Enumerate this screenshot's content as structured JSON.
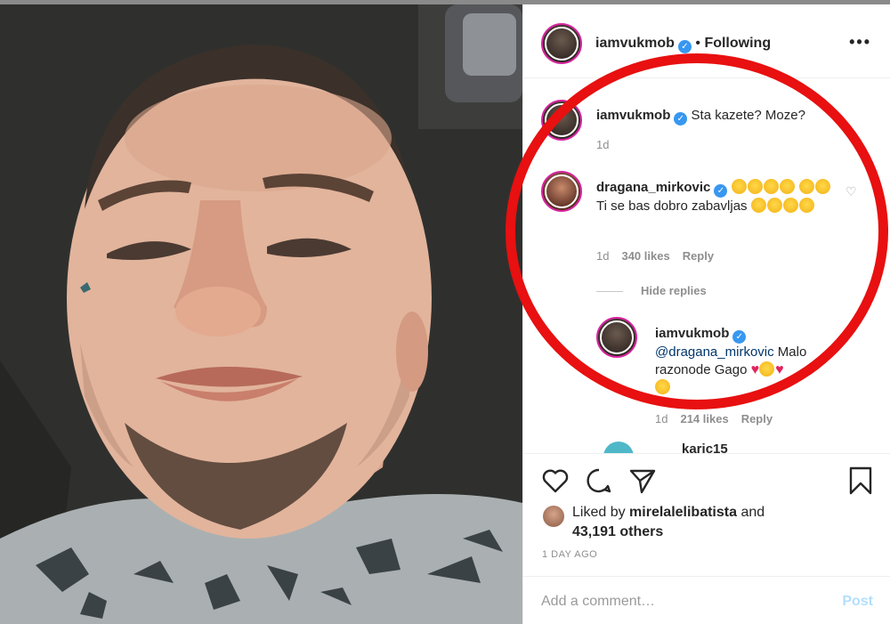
{
  "header": {
    "username": "iamvukmob",
    "separator": "•",
    "follow_state": "Following",
    "more": "•••"
  },
  "comments": [
    {
      "username": "iamvukmob",
      "text": "Sta kazete? Moze?",
      "age": "1d"
    },
    {
      "username": "dragana_mirkovic",
      "text": "Ti se bas dobro zabavljas",
      "age": "1d",
      "likes": "340 likes",
      "reply": "Reply"
    }
  ],
  "hide_replies": "Hide replies",
  "reply": {
    "username": "iamvukmob",
    "mention": "@dragana_mirkovic",
    "text": "Malo razonode Gago",
    "age": "1d",
    "likes": "214 likes",
    "reply": "Reply"
  },
  "next_comment": {
    "username": "karic15"
  },
  "actions": {
    "liked_prefix": "Liked by",
    "liked_user": "mirelalelibatista",
    "liked_and": "and",
    "others": "43,191 others",
    "time_ago": "1 DAY AGO"
  },
  "add_comment": {
    "placeholder": "Add a comment…",
    "post": "Post"
  },
  "colors": {
    "annotation_circle": "#e81010",
    "verified": "#3897f0",
    "link": "#00376b",
    "post_disabled": "#b2dffc"
  }
}
